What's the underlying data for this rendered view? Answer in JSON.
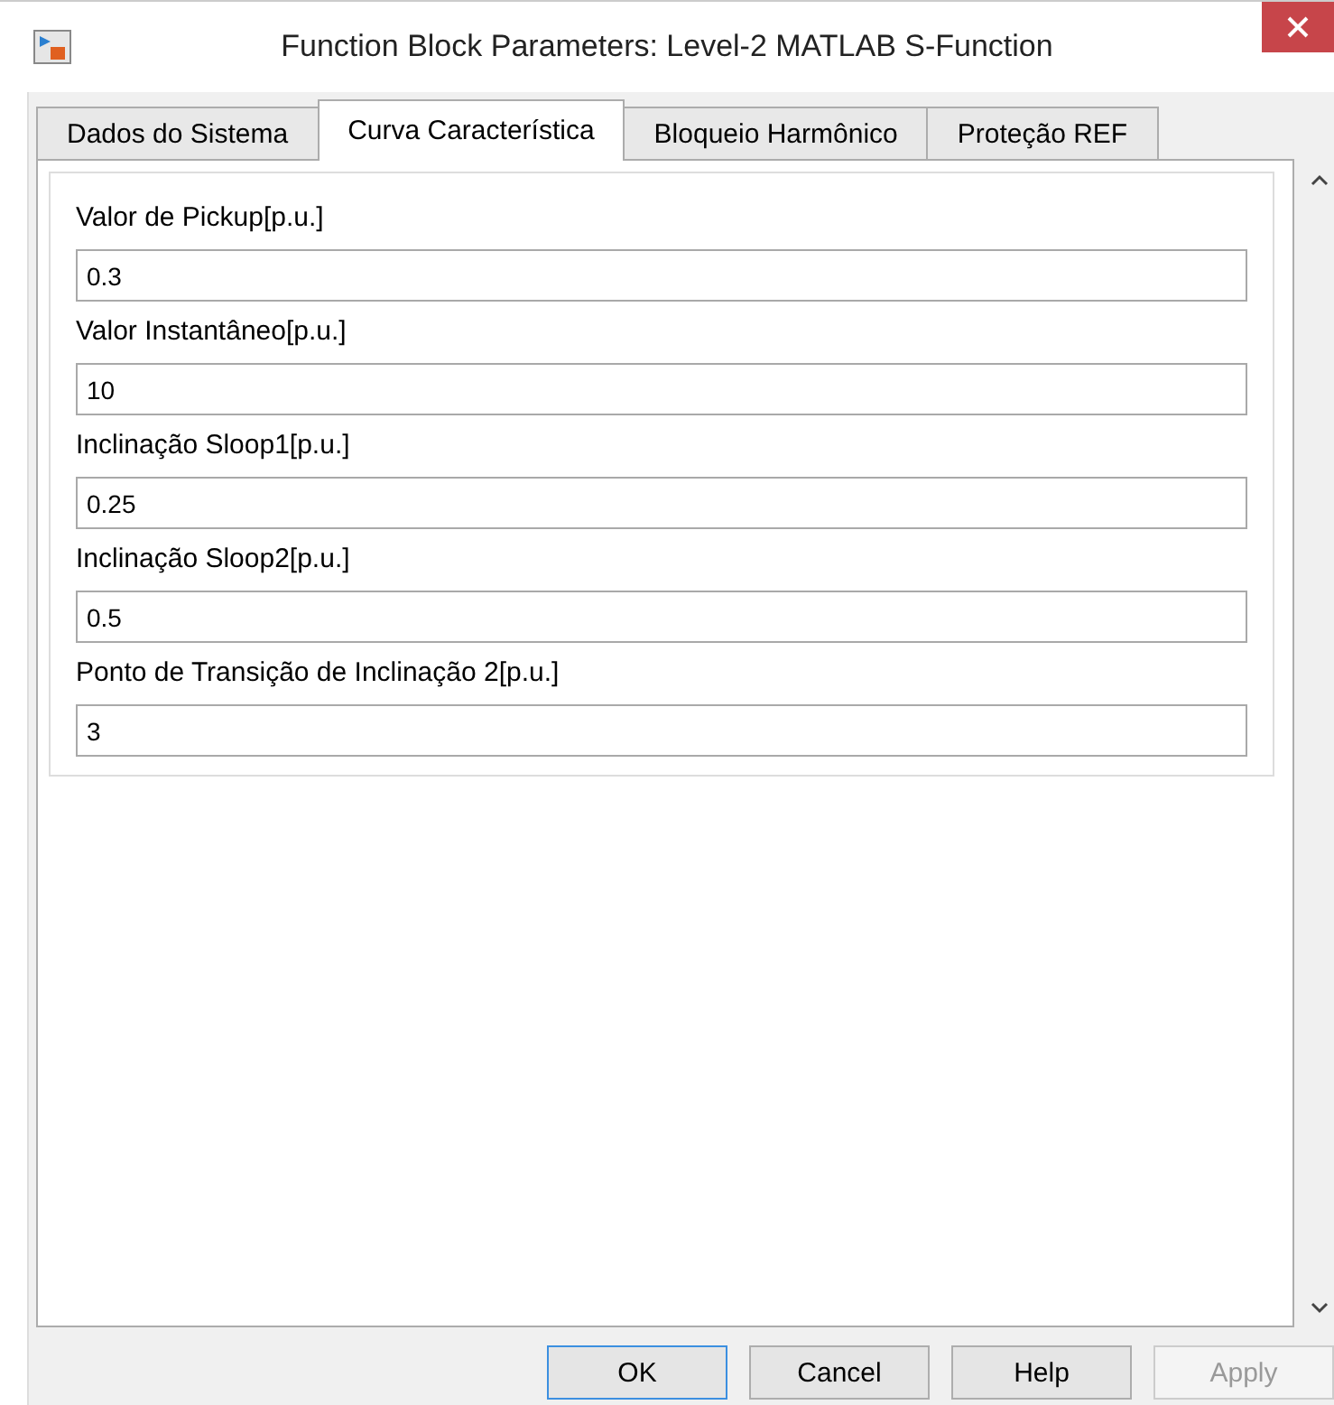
{
  "window": {
    "title": "Function Block Parameters: Level-2 MATLAB S-Function"
  },
  "tabs": [
    {
      "label": "Dados do Sistema",
      "selected": false
    },
    {
      "label": "Curva Característica",
      "selected": true
    },
    {
      "label": "Bloqueio Harmônico",
      "selected": false
    },
    {
      "label": "Proteção REF",
      "selected": false
    }
  ],
  "parameters": [
    {
      "label": "Valor de Pickup[p.u.]",
      "value": "0.3"
    },
    {
      "label": "Valor Instantâneo[p.u.]",
      "value": "10"
    },
    {
      "label": "Inclinação Sloop1[p.u.]",
      "value": "0.25"
    },
    {
      "label": "Inclinação Sloop2[p.u.]",
      "value": "0.5"
    },
    {
      "label": "Ponto de Transição de Inclinação 2[p.u.]",
      "value": "3"
    }
  ],
  "buttons": [
    {
      "label": "OK",
      "disabled": false,
      "default": true
    },
    {
      "label": "Cancel",
      "disabled": false,
      "default": false
    },
    {
      "label": "Help",
      "disabled": false,
      "default": false
    },
    {
      "label": "Apply",
      "disabled": true,
      "default": false
    }
  ]
}
